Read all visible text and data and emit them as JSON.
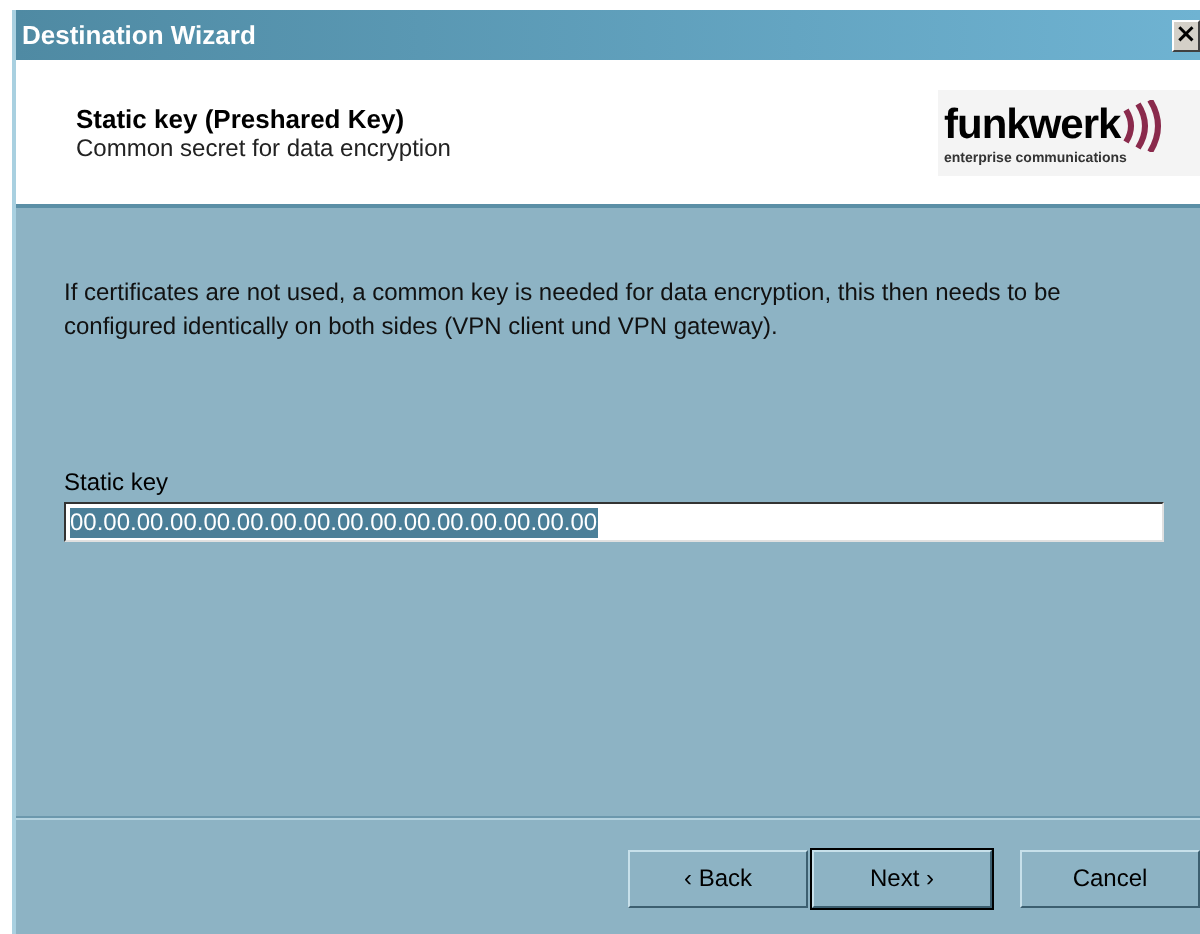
{
  "window": {
    "title": "Destination Wizard",
    "close": "×"
  },
  "header": {
    "title": "Static key (Preshared Key)",
    "subtitle": "Common secret for data encryption",
    "logo": {
      "name": "funkwerk",
      "tagline": "enterprise communications"
    }
  },
  "description": "If certificates are not used, a common key is needed for data encryption, this then needs to be configured identically on both sides (VPN client und VPN gateway).",
  "field": {
    "label": "Static key",
    "value": "00.00.00.00.00.00.00.00.00.00.00.00.00.00.00.00",
    "text_selected": true
  },
  "buttons": [
    {
      "label": "‹ Back",
      "default": false
    },
    {
      "label": "Next ›",
      "default": true
    },
    {
      "label": "Cancel",
      "default": false
    }
  ]
}
